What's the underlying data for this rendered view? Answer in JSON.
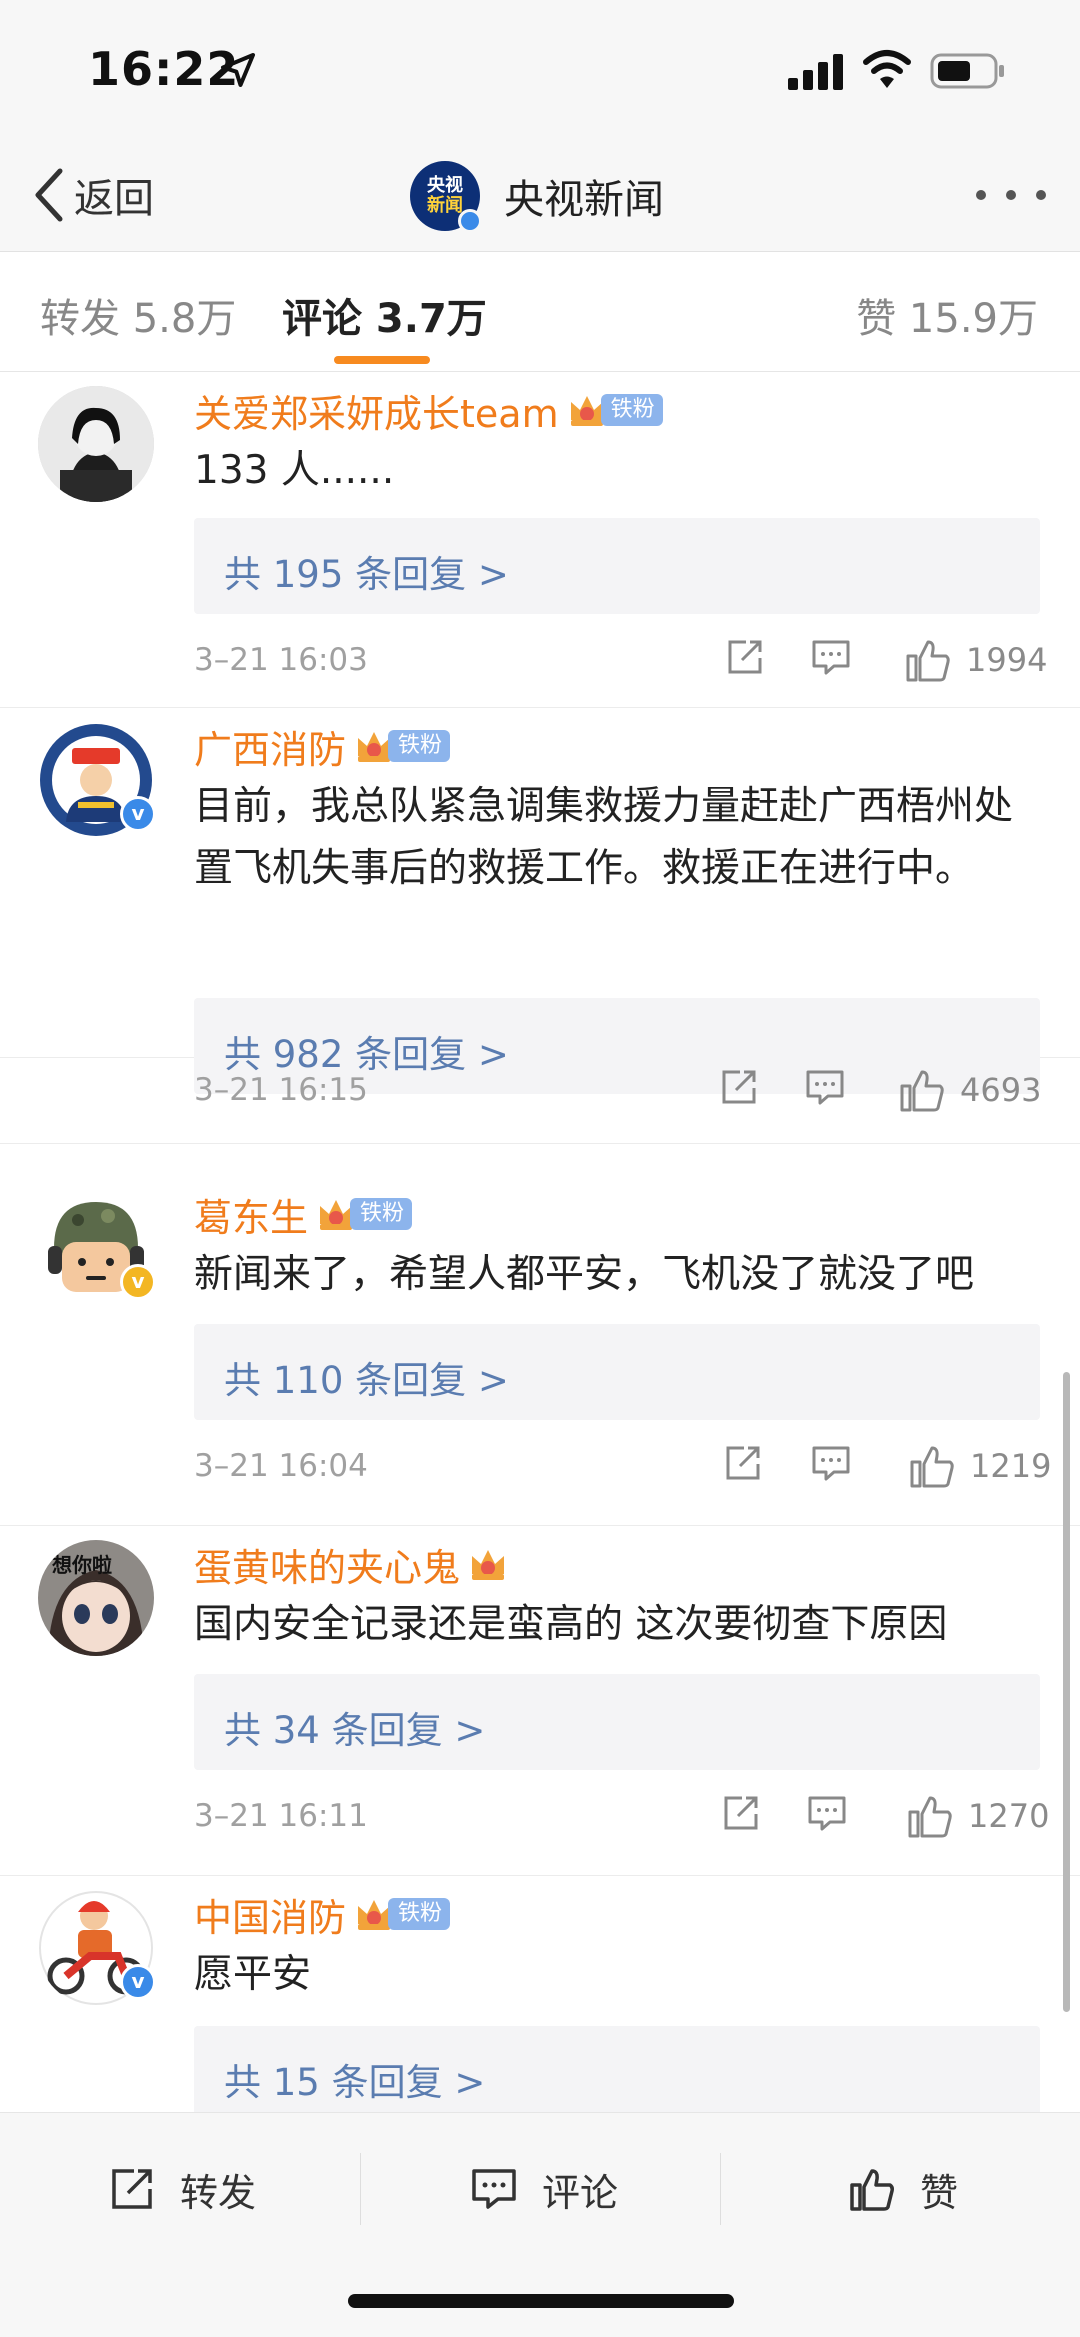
{
  "status_bar": {
    "time": "16:22"
  },
  "nav": {
    "back_label": "返回",
    "title": "央视新闻",
    "logo_line1": "央视",
    "logo_line2": "新闻"
  },
  "tabs": {
    "repost": "转发 5.8万",
    "comment": "评论 3.7万",
    "like": "赞 15.9万"
  },
  "comments": [
    {
      "user": "关爱郑采妍成长team",
      "badge": "铁粉",
      "text": "133 人......",
      "replies": "共 195 条回复 >",
      "date": "3–21 16:03",
      "likes": "1994"
    },
    {
      "user": "广西消防",
      "badge": "铁粉",
      "text": "目前，我总队紧急调集救援力量赶赴广西梧州处置飞机失事后的救援工作。救援正在进行中。",
      "replies": "共 982 条回复 >",
      "date": "3–21 16:15",
      "likes": "4693"
    },
    {
      "user": "葛东生",
      "badge": "铁粉",
      "text": "新闻来了，希望人都平安，飞机没了就没了吧",
      "replies": "共 110 条回复 >",
      "date": "3–21 16:04",
      "likes": "1219"
    },
    {
      "user": "蛋黄味的夹心鬼",
      "badge": "",
      "text": "国内安全记录还是蛮高的 这次要彻查下原因",
      "replies": "共 34 条回复 >",
      "date": "3–21 16:11",
      "likes": "1270"
    },
    {
      "user": "中国消防",
      "badge": "铁粉",
      "text": "愿平安",
      "replies": "共 15 条回复 >"
    }
  ],
  "toolbar": {
    "repost": "转发",
    "comment": "评论",
    "like": "赞"
  },
  "colors": {
    "username": "#f07c1c",
    "reply_link": "#5a7cb0",
    "tab_indicator": "#f78a1f",
    "verified": "#3a8ae8"
  }
}
